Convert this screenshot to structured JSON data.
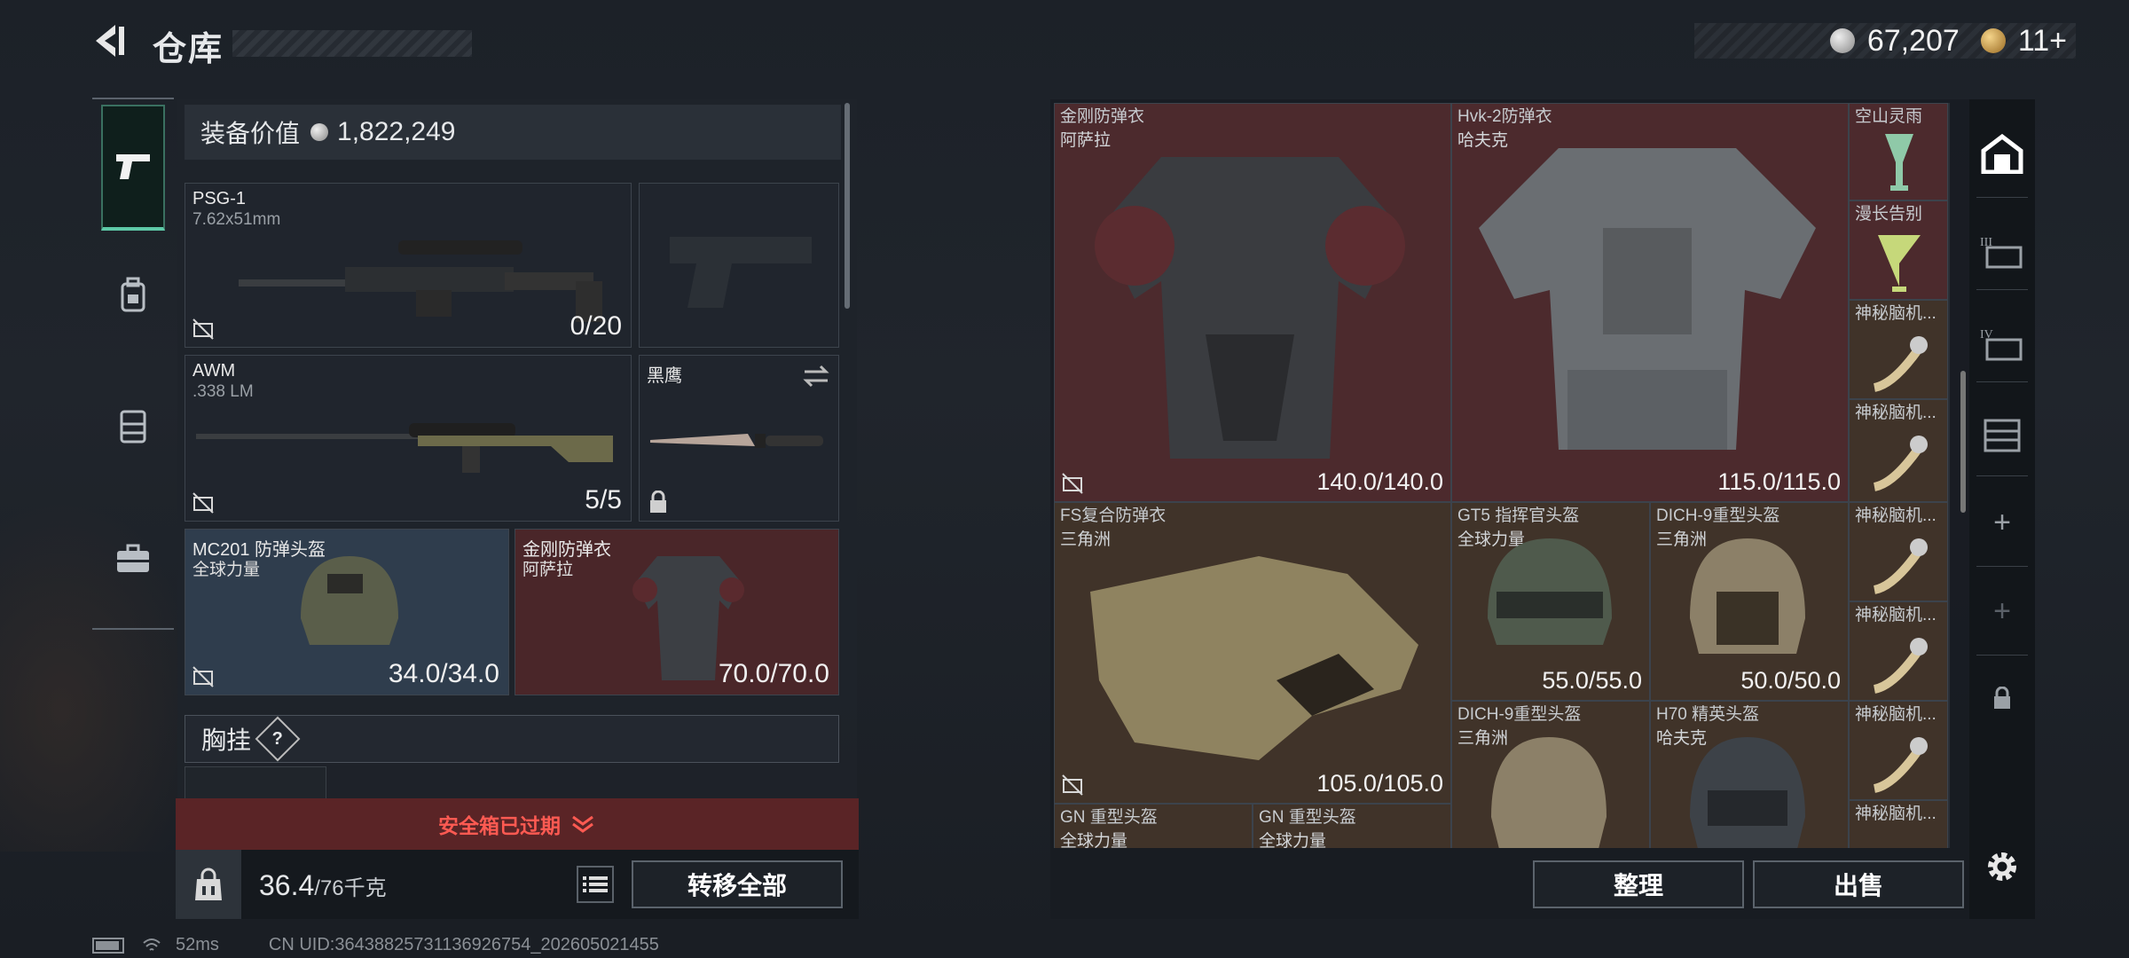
{
  "header": {
    "title": "仓库",
    "back_icon": "back-arrow-icon"
  },
  "currency": [
    {
      "icon": "silver-coin-icon",
      "value": "67,207"
    },
    {
      "icon": "gold-coin-icon",
      "value": "11+"
    }
  ],
  "rail": {
    "items": [
      {
        "icon": "pistol-icon",
        "active": true
      },
      {
        "icon": "backpack-icon",
        "active": false
      },
      {
        "icon": "chest-rig-icon",
        "active": false
      },
      {
        "icon": "toolbox-icon",
        "active": false
      }
    ]
  },
  "equipment": {
    "value_label": "装备价值",
    "value": "1,822,249",
    "slots": {
      "primary1": {
        "name": "PSG-1",
        "caliber": "7.62x51mm",
        "ammo": "0/20"
      },
      "primary2": {
        "name": "AWM",
        "caliber": ".338 LM",
        "ammo": "5/5"
      },
      "knife": {
        "name": "黑鹰"
      },
      "helmet": {
        "name": "MC201 防弹头盔",
        "brand": "全球力量",
        "durability": "34.0/34.0"
      },
      "armor": {
        "name": "金刚防弹衣",
        "brand": "阿萨拉",
        "durability": "70.0/70.0"
      }
    },
    "chest_rig_label": "胸挂",
    "chest_rig_help": "?"
  },
  "safebox": {
    "expired_text": "安全箱已过期"
  },
  "footer": {
    "weight": "36.4",
    "weight_max": "/76千克",
    "transfer_all": "转移全部"
  },
  "inventory": {
    "items": [
      {
        "name": "金刚防弹衣",
        "brand": "阿萨拉",
        "durability": "140.0/140.0"
      },
      {
        "name": "Hvk-2防弹衣",
        "brand": "哈夫克",
        "durability": "115.0/115.0"
      },
      {
        "name": "空山灵雨"
      },
      {
        "name": "漫长告别"
      },
      {
        "name": "神秘脑机..."
      },
      {
        "name": "FS复合防弹衣",
        "brand": "三角洲",
        "durability": "105.0/105.0"
      },
      {
        "name": "GT5 指挥官头盔",
        "brand": "全球力量",
        "durability": "55.0/55.0"
      },
      {
        "name": "DICH-9重型头盔",
        "brand": "三角洲",
        "durability": "50.0/50.0"
      },
      {
        "name": "DICH-9重型头盔",
        "brand": "三角洲"
      },
      {
        "name": "H70 精英头盔",
        "brand": "哈夫克"
      },
      {
        "name": "GN 重型头盔",
        "brand": "全球力量"
      },
      {
        "name": "GN 重型头盔",
        "brand": "全球力量"
      }
    ],
    "arrange": "整理",
    "sell": "出售"
  },
  "side_tabs": {
    "plus": "+",
    "tiers": [
      "III",
      "IV"
    ]
  },
  "status": {
    "ping": "52ms",
    "uid": "CN UID:3643882573113692675​4_202605021455"
  }
}
